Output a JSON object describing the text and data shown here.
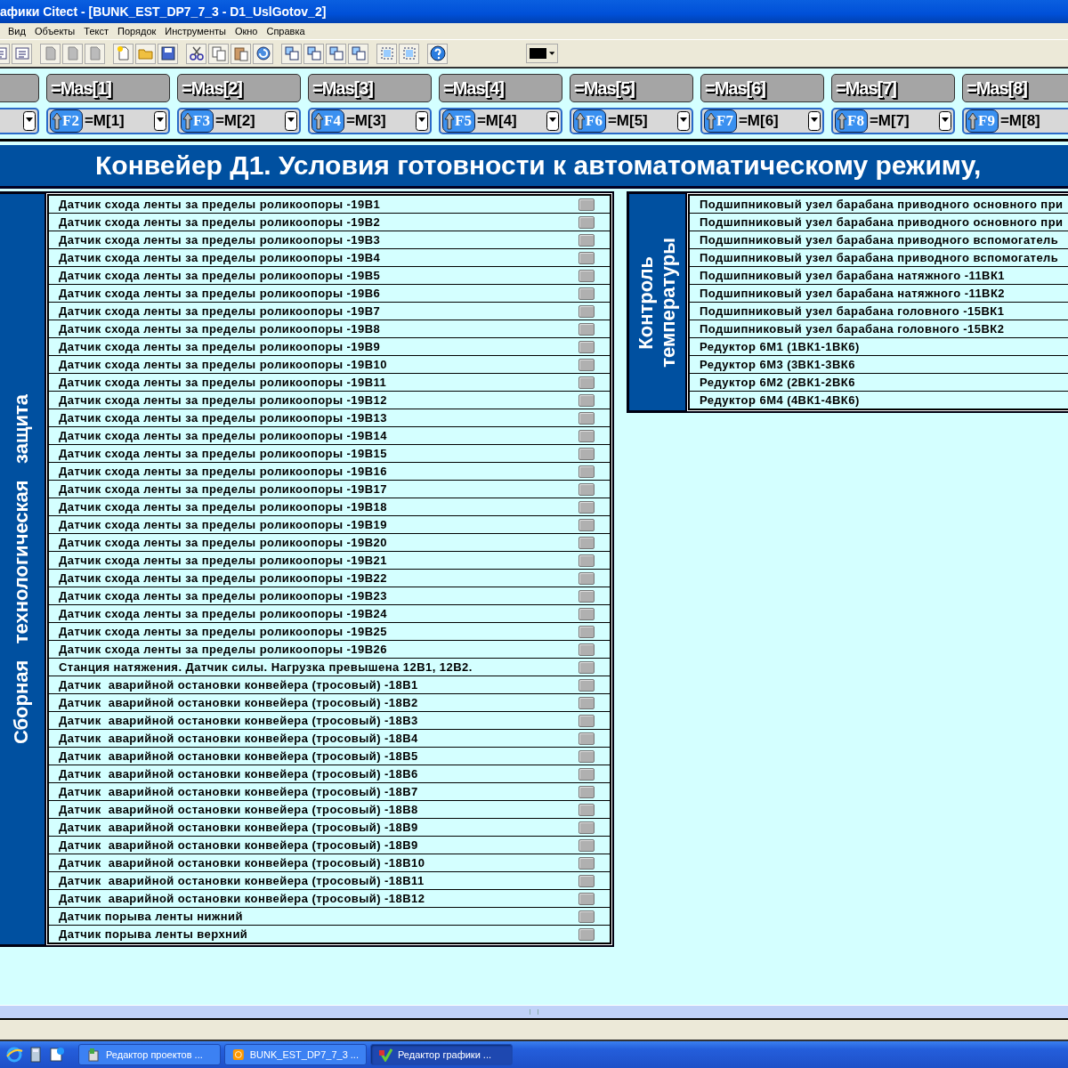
{
  "window": {
    "title": "афики Citect - [BUNK_EST_DP7_7_3 - D1_UslGotov_2]"
  },
  "menu": [
    "Вид",
    "Объекты",
    "Текст",
    "Порядок",
    "Инструменты",
    "Окно",
    "Справка"
  ],
  "mas_buttons": [
    "=Mas[1]",
    "=Mas[2]",
    "=Mas[3]",
    "=Mas[4]",
    "=Mas[5]",
    "=Mas[6]",
    "=Mas[7]",
    "=Mas[8]"
  ],
  "function_keys": [
    {
      "key": "F2",
      "value": "=M[1]"
    },
    {
      "key": "F3",
      "value": "=M[2]"
    },
    {
      "key": "F4",
      "value": "=M[3]"
    },
    {
      "key": "F5",
      "value": "=M[4]"
    },
    {
      "key": "F6",
      "value": "=M[5]"
    },
    {
      "key": "F7",
      "value": "=M[6]"
    },
    {
      "key": "F8",
      "value": "=M[7]"
    },
    {
      "key": "F9",
      "value": "=M[8]"
    }
  ],
  "header": {
    "title": "Конвейер Д1. Условия готовности к автоматоматическому режиму,"
  },
  "panels": [
    {
      "kind": "indicators",
      "label": [
        "Сборная   технологическая   защита"
      ],
      "rows": [
        "Датчик схода ленты за пределы роликоопоры -19В1",
        "Датчик схода ленты за пределы роликоопоры -19В2",
        "Датчик схода ленты за пределы роликоопоры -19В3",
        "Датчик схода ленты за пределы роликоопоры -19В4",
        "Датчик схода ленты за пределы роликоопоры -19В5",
        "Датчик схода ленты за пределы роликоопоры -19В6",
        "Датчик схода ленты за пределы роликоопоры -19В7",
        "Датчик схода ленты за пределы роликоопоры -19В8",
        "Датчик схода ленты за пределы роликоопоры -19В9",
        "Датчик схода ленты за пределы роликоопоры -19В10",
        "Датчик схода ленты за пределы роликоопоры -19В11",
        "Датчик схода ленты за пределы роликоопоры -19В12",
        "Датчик схода ленты за пределы роликоопоры -19В13",
        "Датчик схода ленты за пределы роликоопоры -19В14",
        "Датчик схода ленты за пределы роликоопоры -19В15",
        "Датчик схода ленты за пределы роликоопоры -19В16",
        "Датчик схода ленты за пределы роликоопоры -19В17",
        "Датчик схода ленты за пределы роликоопоры -19В18",
        "Датчик схода ленты за пределы роликоопоры -19В19",
        "Датчик схода ленты за пределы роликоопоры -19В20",
        "Датчик схода ленты за пределы роликоопоры -19В21",
        "Датчик схода ленты за пределы роликоопоры -19В22",
        "Датчик схода ленты за пределы роликоопоры -19В23",
        "Датчик схода ленты за пределы роликоопоры -19В24",
        "Датчик схода ленты за пределы роликоопоры -19В25",
        "Датчик схода ленты за пределы роликоопоры -19В26",
        "Станция натяжения. Датчик силы. Нагрузка превышена 12В1, 12В2.",
        "Датчик  аварийной остановки конвейера (тросовый) -18В1",
        "Датчик  аварийной остановки конвейера (тросовый) -18В2",
        "Датчик  аварийной остановки конвейера (тросовый) -18В3",
        "Датчик  аварийной остановки конвейера (тросовый) -18В4",
        "Датчик  аварийной остановки конвейера (тросовый) -18В5",
        "Датчик  аварийной остановки конвейера (тросовый) -18В6",
        "Датчик  аварийной остановки конвейера (тросовый) -18В7",
        "Датчик  аварийной остановки конвейера (тросовый) -18В8",
        "Датчик  аварийной остановки конвейера (тросовый) -18В9",
        "Датчик  аварийной остановки конвейера (тросовый) -18В9",
        "Датчик  аварийной остановки конвейера (тросовый) -18В10",
        "Датчик  аварийной остановки конвейера (тросовый) -18В11",
        "Датчик  аварийной остановки конвейера (тросовый) -18В12",
        "Датчик порыва ленты нижний",
        "Датчик порыва ленты верхний"
      ]
    },
    {
      "kind": "plain",
      "label": [
        "Контроль",
        "температуры"
      ],
      "rows": [
        "Подшипниковый узел барабана приводного основного при",
        "Подшипниковый узел барабана приводного основного при",
        "Подшипниковый узел барабана приводного вспомогатель",
        "Подшипниковый узел барабана приводного вспомогатель",
        "Подшипниковый узел барабана натяжного -11ВК1",
        "Подшипниковый узел барабана натяжного -11ВК2",
        "Подшипниковый узел барабана головного -15ВК1",
        "Подшипниковый узел барабана головного -15ВК2",
        "Редуктор 6М1 (1ВК1-1ВК6)",
        "Редуктор 6М3 (3ВК1-3ВК6",
        "Редуктор 6М2 (2ВК1-2ВК6",
        "Редуктор 6М4 (4ВК1-4ВК6)"
      ]
    }
  ],
  "taskbar": [
    {
      "label": "Редактор проектов ...",
      "selected": false
    },
    {
      "label": "BUNK_EST_DP7_7_3 ...",
      "selected": false
    },
    {
      "label": "Редактор графики ...",
      "selected": true
    }
  ]
}
